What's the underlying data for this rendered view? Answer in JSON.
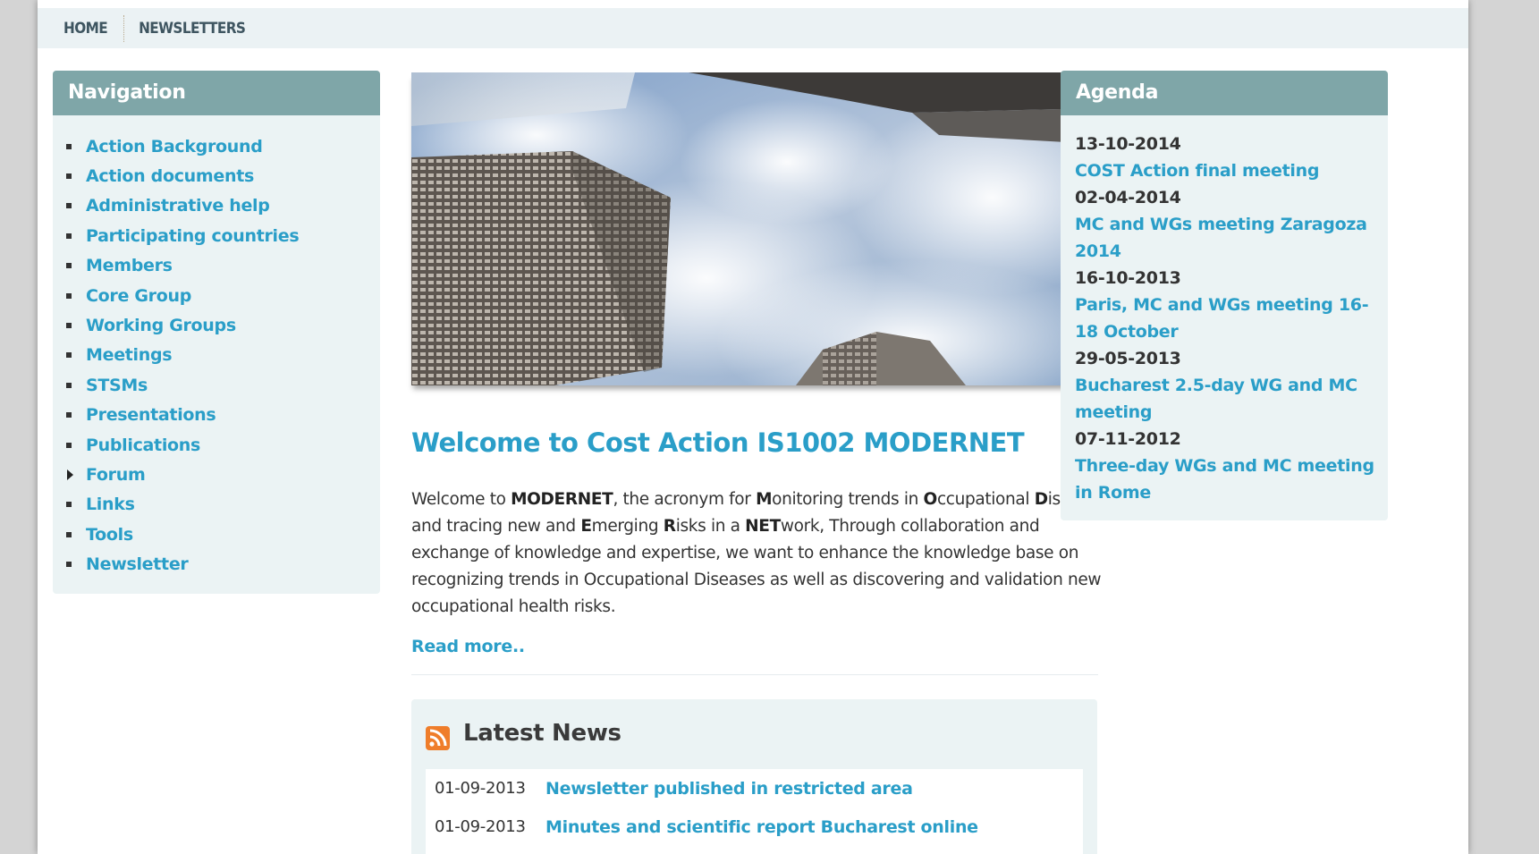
{
  "topnav": {
    "home": "HOME",
    "newsletters": "NEWSLETTERS"
  },
  "navigation": {
    "title": "Navigation",
    "items": [
      {
        "label": "Action Background",
        "marker": "bullet"
      },
      {
        "label": "Action documents",
        "marker": "bullet"
      },
      {
        "label": "Administrative help",
        "marker": "bullet"
      },
      {
        "label": "Participating countries",
        "marker": "bullet"
      },
      {
        "label": "Members",
        "marker": "bullet"
      },
      {
        "label": "Core Group",
        "marker": "bullet"
      },
      {
        "label": "Working Groups",
        "marker": "bullet"
      },
      {
        "label": "Meetings",
        "marker": "bullet"
      },
      {
        "label": "STSMs",
        "marker": "bullet"
      },
      {
        "label": "Presentations",
        "marker": "bullet"
      },
      {
        "label": "Publications",
        "marker": "bullet"
      },
      {
        "label": "Forum",
        "marker": "arrow"
      },
      {
        "label": "Links",
        "marker": "bullet"
      },
      {
        "label": "Tools",
        "marker": "bullet"
      },
      {
        "label": "Newsletter",
        "marker": "bullet"
      }
    ]
  },
  "main": {
    "title": "Welcome to Cost Action IS1002 MODERNET",
    "intro": {
      "s01": "Welcome to ",
      "s02": "MODERNET",
      "s03": ", the acronym for ",
      "s04": "M",
      "s05": "onitoring trends in ",
      "s06": "O",
      "s07": "ccupational ",
      "s08": "D",
      "s09": "iseases and tracing new and ",
      "s10": "E",
      "s11": "merging ",
      "s12": "R",
      "s13": "isks in a ",
      "s14": "NET",
      "s15": "work, Through collaboration and exchange of knowledge and expertise, we want to enhance the knowledge base on recognizing trends in Occupational Diseases as well as discovering and validation new occupational health risks."
    },
    "read_more": "Read more.."
  },
  "news": {
    "title": "Latest News",
    "items": [
      {
        "date": "01-09-2013",
        "title": "Newsletter published in restricted area"
      },
      {
        "date": "01-09-2013",
        "title": "Minutes and scientific report Bucharest online"
      }
    ]
  },
  "agenda": {
    "title": "Agenda",
    "items": [
      {
        "date": "13-10-2014",
        "title": "COST Action final meeting"
      },
      {
        "date": "02-04-2014",
        "title": "MC and WGs meeting Zaragoza 2014"
      },
      {
        "date": "16-10-2013",
        "title": "Paris, MC and WGs meeting 16-18 October"
      },
      {
        "date": "29-05-2013",
        "title": "Bucharest 2.5-day WG and MC meeting"
      },
      {
        "date": "07-11-2012",
        "title": "Three-day WGs and MC meeting in Rome"
      }
    ]
  },
  "colors": {
    "link": "#2a9ec8",
    "box_header": "#7fa6a8",
    "box_bg": "#ebf3f4",
    "rss": "#ef7d2a"
  },
  "icons": {
    "rss": "rss-feed-icon",
    "bullet": "square-bullet-icon",
    "forum_marker": "triangle-right-icon"
  }
}
